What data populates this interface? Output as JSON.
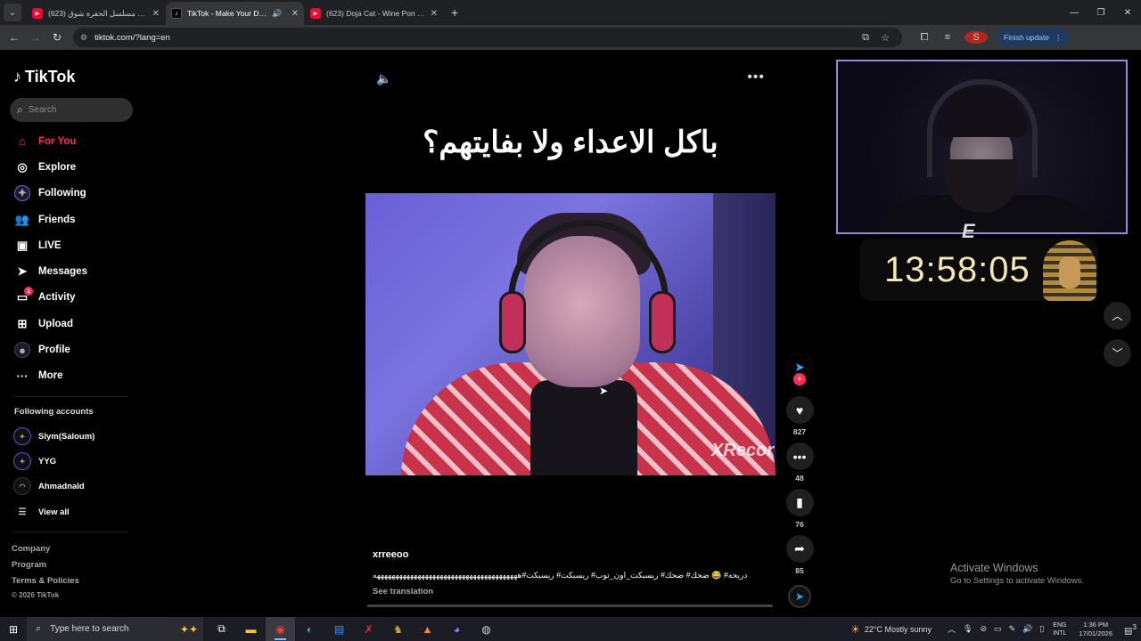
{
  "browser": {
    "tabs": [
      {
        "title": "(623) اغنية مسلسل الحفرة شوق",
        "favicon": "youtube-icon",
        "active": false
      },
      {
        "title": "TikTok - Make Your Day",
        "favicon": "tiktok-icon",
        "active": true
      },
      {
        "title": "(623) Doja Cat - Wine Pon You",
        "favicon": "youtube-icon",
        "active": false
      }
    ],
    "url": "tiktok.com/?lang=en",
    "profile_initial": "S",
    "finish_update": "Finish update"
  },
  "sidebar": {
    "brand": "TikTok",
    "search_placeholder": "Search",
    "nav": [
      {
        "label": "For You",
        "icon": "home-icon",
        "active": true
      },
      {
        "label": "Explore",
        "icon": "compass-icon"
      },
      {
        "label": "Following",
        "icon": "following-avatar-icon"
      },
      {
        "label": "Friends",
        "icon": "friends-icon"
      },
      {
        "label": "LIVE",
        "icon": "live-tv-icon"
      },
      {
        "label": "Messages",
        "icon": "send-icon"
      },
      {
        "label": "Activity",
        "icon": "inbox-icon",
        "badge": "1"
      },
      {
        "label": "Upload",
        "icon": "plus-square-icon"
      },
      {
        "label": "Profile",
        "icon": "profile-avatar-icon"
      },
      {
        "label": "More",
        "icon": "ellipsis-icon"
      }
    ],
    "following_title": "Following accounts",
    "following": [
      "Slym(Saloum)",
      "YYG",
      "Ahmadnald"
    ],
    "view_all": "View all",
    "footer": [
      "Company",
      "Program",
      "Terms & Policies"
    ],
    "copyright": "© 2026 TikTok"
  },
  "video": {
    "headline": "باكل الاعداء ولا بفايتهم؟",
    "watermark": "XRecor",
    "author": "xrreeoo",
    "caption": "دريحه# 😂 ضحك# ضحك# ريسبكت_اون_توب# ريسبكت# ريسبكت#هههههههههههههههههههههههههههههههههههههههه",
    "see_translation": "See translation",
    "progress": 0,
    "likes": "827",
    "comments": "48",
    "saves": "76",
    "shares": "85"
  },
  "overlay": {
    "clock": "13:58:05",
    "clock_logo": "E"
  },
  "windows_notice": {
    "title": "Activate Windows",
    "subtitle": "Go to Settings to activate Windows."
  },
  "taskbar": {
    "search_placeholder": "Type here to search",
    "weather": "22°C  Mostly sunny",
    "lang_top": "ENG",
    "lang_bottom": "INTL",
    "time": "1:36 PM",
    "date": "17/01/2026",
    "notifications": "3"
  }
}
